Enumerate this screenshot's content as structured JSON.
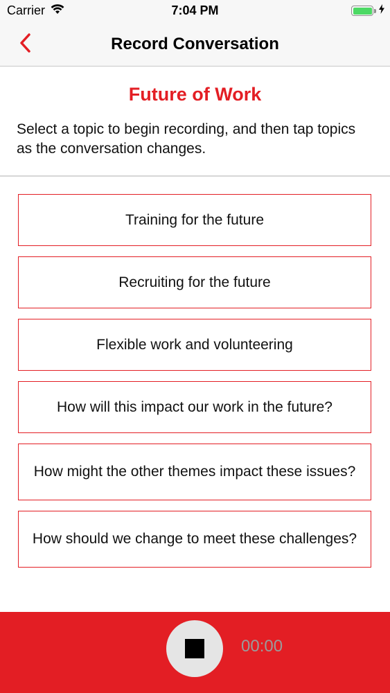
{
  "status_bar": {
    "carrier": "Carrier",
    "wifi_icon": "wifi-icon",
    "time": "7:04 PM",
    "battery_icon": "battery-icon",
    "charging_icon": "bolt-icon",
    "battery_level": 1.0,
    "battery_color": "#4cd964"
  },
  "nav": {
    "back_icon": "chevron-left-icon",
    "title": "Record Conversation"
  },
  "header": {
    "title": "Future of Work",
    "instructions": "Select a topic to begin recording, and then tap topics as the conversation changes."
  },
  "topics": [
    {
      "label": "Training for the future"
    },
    {
      "label": "Recruiting for the future"
    },
    {
      "label": "Flexible work and volunteering"
    },
    {
      "label": "How will this impact our work in the future?"
    },
    {
      "label": "How might the other themes impact these issues?"
    },
    {
      "label": "How should we change to meet these challenges?"
    }
  ],
  "recorder": {
    "stop_icon": "stop-icon",
    "timer": "00:00"
  },
  "colors": {
    "accent": "#e31e24",
    "record_bar": "#e31e24",
    "stop_button_bg": "#e5e5e5",
    "timer_text": "#9b9b9b"
  }
}
